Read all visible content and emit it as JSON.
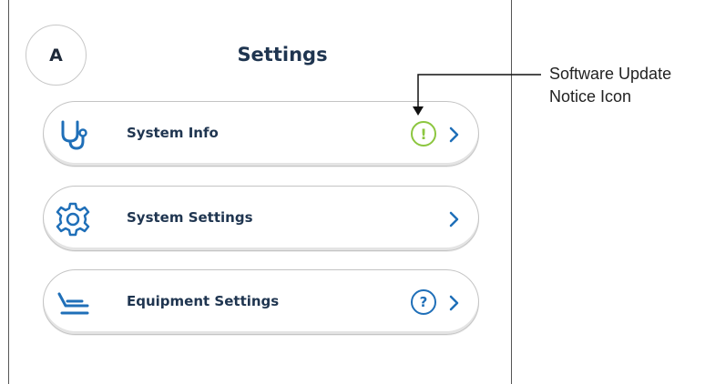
{
  "header": {
    "avatar_letter": "A",
    "title": "Settings"
  },
  "menu": {
    "items": [
      {
        "label": "System Info",
        "icon": "stethoscope-icon",
        "badge": "!",
        "badge_type": "software-update-notice",
        "chevron": "chevron-right-icon"
      },
      {
        "label": "System Settings",
        "icon": "gear-icon",
        "badge": null,
        "chevron": "chevron-right-icon"
      },
      {
        "label": "Equipment Settings",
        "icon": "dental-chair-icon",
        "badge": "?",
        "badge_type": "help",
        "chevron": "chevron-right-icon"
      }
    ]
  },
  "callout": {
    "line1": "Software Update",
    "line2": "Notice Icon"
  },
  "colors": {
    "primary": "#1f6fb8",
    "text_dark": "#1f3550",
    "notice_green": "#8cc63f",
    "pill_border": "#c4c4c4"
  }
}
